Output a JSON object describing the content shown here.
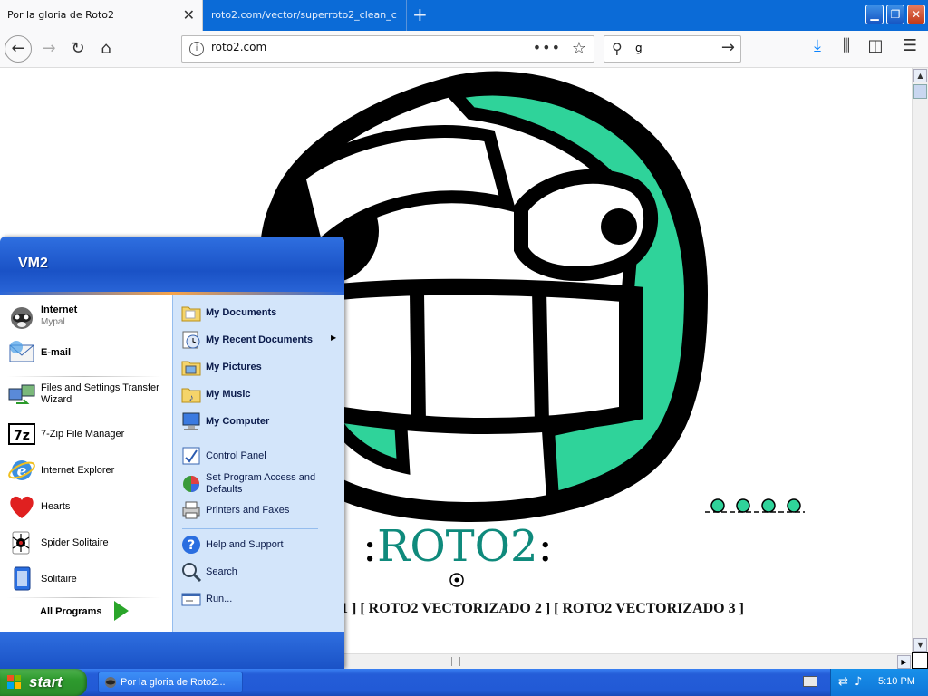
{
  "browser": {
    "tabs": [
      {
        "title": "Por la gloria de Roto2",
        "active": true
      },
      {
        "title": "roto2.com/vector/superroto2_clean_c",
        "active": false
      }
    ],
    "url": "roto2.com",
    "search_value": "g"
  },
  "page": {
    "title_prefix": ":",
    "title_main": "ROTO2",
    "title_suffix": ":",
    "links_prefix": "1 ] [ ",
    "link2": "ROTO2 VECTORIZADO 2",
    "links_mid": " ] [ ",
    "link3": "ROTO2 VECTORIZADO 3",
    "links_suffix": " ]",
    "link1_partial": "1",
    "colors": {
      "teal": "#0f8a7c",
      "face_green": "#2fd39a"
    }
  },
  "start_menu": {
    "user": "VM2",
    "pinned": [
      {
        "label": "Internet",
        "sub": "Mypal",
        "icon": "raccoon-browser-icon"
      },
      {
        "label": "E-mail",
        "sub": "",
        "icon": "email-icon"
      }
    ],
    "recent": [
      {
        "label": "Files and Settings Transfer Wizard",
        "icon": "transfer-wizard-icon"
      },
      {
        "label": "7-Zip File Manager",
        "icon": "7zip-icon"
      },
      {
        "label": "Internet Explorer",
        "icon": "internet-explorer-icon"
      },
      {
        "label": "Hearts",
        "icon": "hearts-icon"
      },
      {
        "label": "Spider Solitaire",
        "icon": "spider-solitaire-icon"
      },
      {
        "label": "Solitaire",
        "icon": "solitaire-icon"
      }
    ],
    "all_programs": "All Programs",
    "places": [
      {
        "label": "My Documents",
        "icon": "folder-documents-icon"
      },
      {
        "label": "My Recent Documents",
        "icon": "recent-documents-icon"
      },
      {
        "label": "My Pictures",
        "icon": "folder-pictures-icon"
      },
      {
        "label": "My Music",
        "icon": "folder-music-icon"
      },
      {
        "label": "My Computer",
        "icon": "my-computer-icon"
      }
    ],
    "settings": [
      {
        "label": "Control Panel",
        "icon": "control-panel-icon"
      },
      {
        "label": "Set Program Access and Defaults",
        "icon": "program-access-icon"
      },
      {
        "label": "Printers and Faxes",
        "icon": "printer-icon"
      }
    ],
    "help": [
      {
        "label": "Help and Support",
        "icon": "help-icon"
      },
      {
        "label": "Search",
        "icon": "search-icon"
      },
      {
        "label": "Run...",
        "icon": "run-icon"
      }
    ]
  },
  "taskbar": {
    "start_label": "start",
    "task_label": "Por la gloria de Roto2...",
    "clock": "5:10 PM"
  }
}
